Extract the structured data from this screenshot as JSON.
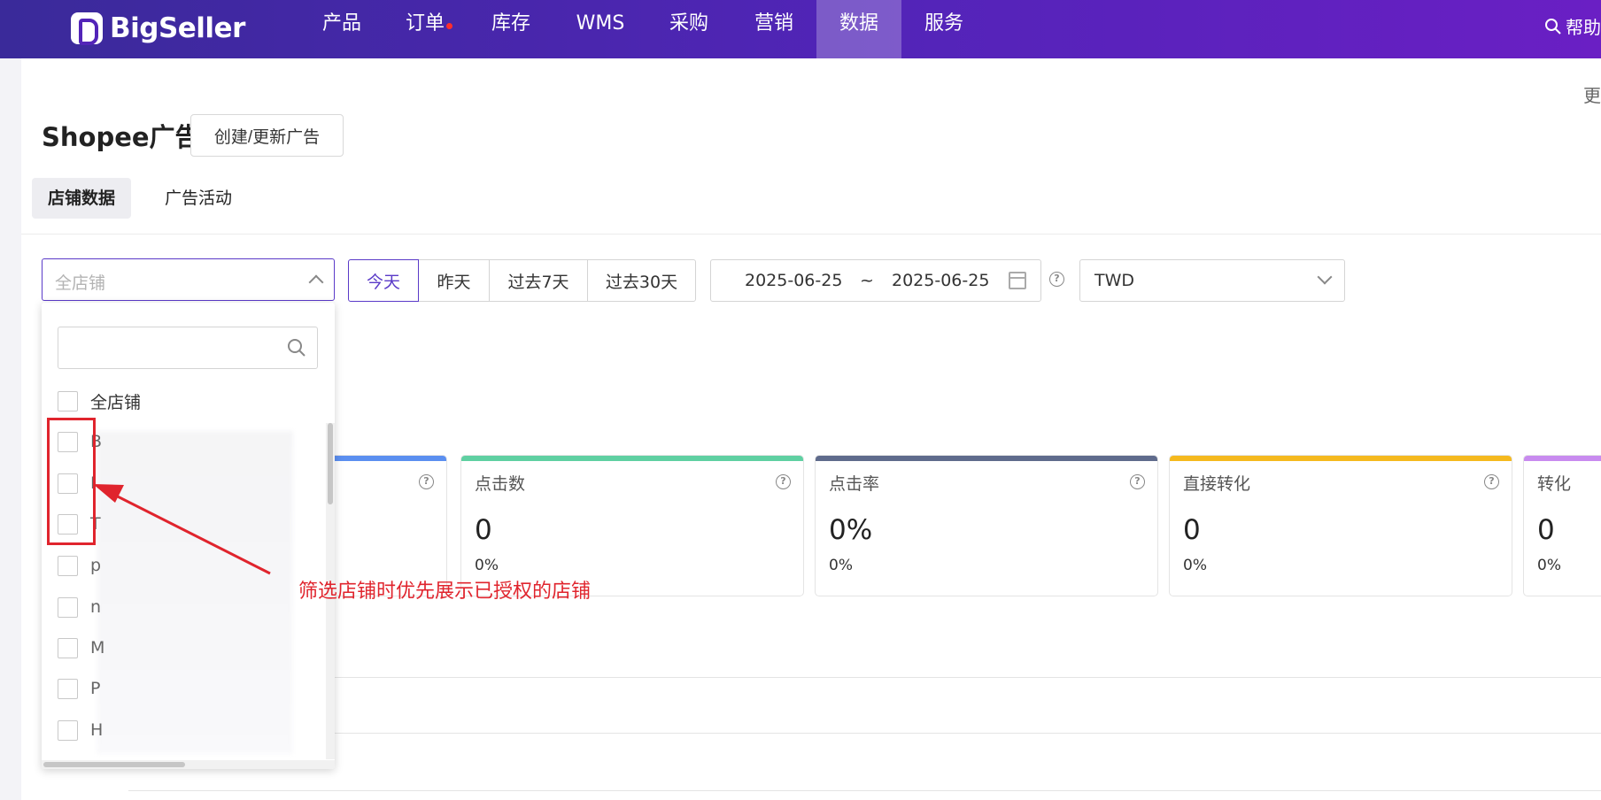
{
  "nav": {
    "brand": "BigSeller",
    "items": [
      {
        "label": "产品",
        "active": false,
        "dot": false
      },
      {
        "label": "订单",
        "active": false,
        "dot": true
      },
      {
        "label": "库存",
        "active": false,
        "dot": false
      },
      {
        "label": "WMS",
        "active": false,
        "dot": false
      },
      {
        "label": "采购",
        "active": false,
        "dot": false
      },
      {
        "label": "营销",
        "active": false,
        "dot": false
      },
      {
        "label": "数据",
        "active": true,
        "dot": false
      },
      {
        "label": "服务",
        "active": false,
        "dot": false
      }
    ],
    "help_label": "帮助"
  },
  "page": {
    "title": "Shopee广告",
    "create_button": "创建/更新广告",
    "edge_text": "更",
    "tabs": [
      {
        "label": "店铺数据",
        "active": true
      },
      {
        "label": "广告活动",
        "active": false
      }
    ]
  },
  "filters": {
    "store_placeholder": "全店铺",
    "date_options": [
      {
        "label": "今天",
        "active": true
      },
      {
        "label": "昨天",
        "active": false
      },
      {
        "label": "过去7天",
        "active": false
      },
      {
        "label": "过去30天",
        "active": false
      }
    ],
    "date_start": "2025-06-25",
    "date_sep": "~",
    "date_end": "2025-06-25",
    "currency": "TWD"
  },
  "dropdown": {
    "search_placeholder": "",
    "options": [
      {
        "label": "全店铺"
      },
      {
        "label": "B"
      },
      {
        "label": "I"
      },
      {
        "label": "T"
      },
      {
        "label": "p"
      },
      {
        "label": "n"
      },
      {
        "label": "M"
      },
      {
        "label": "P"
      },
      {
        "label": "H"
      }
    ]
  },
  "metrics": [
    {
      "label": "",
      "value": "",
      "pct": "",
      "color": "#5b8ff0"
    },
    {
      "label": "点击数",
      "value": "0",
      "pct": "0%",
      "color": "#5fd0a2"
    },
    {
      "label": "点击率",
      "value": "0%",
      "pct": "0%",
      "color": "#5f6b8c"
    },
    {
      "label": "直接转化",
      "value": "0",
      "pct": "0%",
      "color": "#f5b91e"
    },
    {
      "label": "转化",
      "value": "0",
      "pct": "0%",
      "color": "#c88bef"
    }
  ],
  "annotation": {
    "text": "筛选店铺时优先展示已授权的店铺",
    "color": "#e0242d"
  },
  "colors": {
    "nav_start": "#3a2a9a",
    "nav_end": "#6a1fc4",
    "accent": "#5a3ac8"
  }
}
